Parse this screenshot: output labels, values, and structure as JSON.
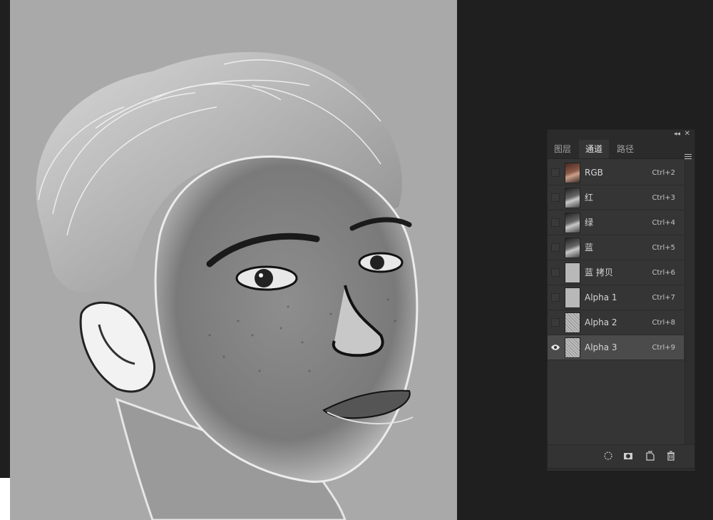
{
  "panel": {
    "tabs": [
      {
        "label": "图层",
        "active": false
      },
      {
        "label": "通道",
        "active": true
      },
      {
        "label": "路径",
        "active": false
      }
    ],
    "channels": [
      {
        "name": "RGB",
        "shortcut": "Ctrl+2",
        "visible": false,
        "thumb": "rgb"
      },
      {
        "name": "红",
        "shortcut": "Ctrl+3",
        "visible": false,
        "thumb": "gray"
      },
      {
        "name": "绿",
        "shortcut": "Ctrl+4",
        "visible": false,
        "thumb": "gray"
      },
      {
        "name": "蓝",
        "shortcut": "Ctrl+5",
        "visible": false,
        "thumb": "gray"
      },
      {
        "name": "蓝 拷贝",
        "shortcut": "Ctrl+6",
        "visible": false,
        "thumb": "light"
      },
      {
        "name": "Alpha 1",
        "shortcut": "Ctrl+7",
        "visible": false,
        "thumb": "light"
      },
      {
        "name": "Alpha 2",
        "shortcut": "Ctrl+8",
        "visible": false,
        "thumb": "sketch"
      },
      {
        "name": "Alpha 3",
        "shortcut": "Ctrl+9",
        "visible": true,
        "thumb": "sketch",
        "selected": true
      }
    ],
    "bottom_icons": [
      "load-selection-icon",
      "save-selection-icon",
      "new-channel-icon",
      "delete-channel-icon"
    ]
  },
  "colors": {
    "panel_bg": "#353535",
    "canvas_bg": "#a9a9a9",
    "app_bg": "#1f1f1f",
    "selected_row": "#4b4b4b"
  }
}
